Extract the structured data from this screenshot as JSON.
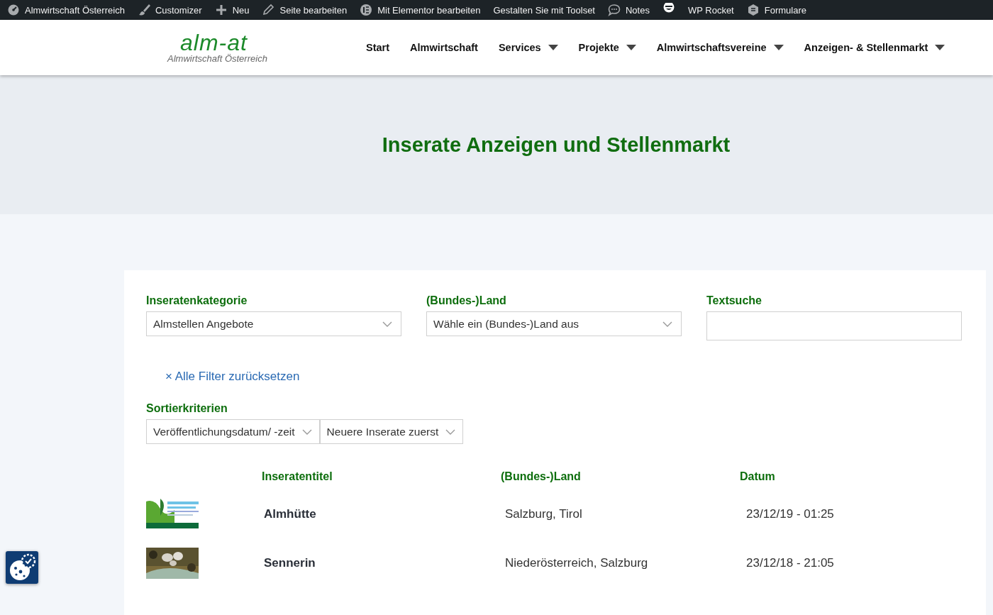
{
  "admin_bar": [
    {
      "kind": "dashboard",
      "label": "Almwirtschaft Österreich"
    },
    {
      "kind": "brush",
      "label": "Customizer"
    },
    {
      "kind": "plus",
      "label": "Neu"
    },
    {
      "kind": "pencil",
      "label": "Seite bearbeiten"
    },
    {
      "kind": "elementor",
      "label": "Mit Elementor bearbeiten"
    },
    {
      "kind": "none",
      "label": "Gestalten Sie mit Toolset"
    },
    {
      "kind": "comment",
      "label": "Notes"
    },
    {
      "kind": "face"
    },
    {
      "kind": "none",
      "label": "WP Rocket"
    },
    {
      "kind": "form",
      "label": "Formulare"
    }
  ],
  "logo": {
    "title": "alm-at",
    "subtitle": "Almwirtschaft Österreich"
  },
  "nav": [
    {
      "label": "Start",
      "dropdown": false
    },
    {
      "label": "Almwirtschaft",
      "dropdown": false
    },
    {
      "label": "Services",
      "dropdown": true
    },
    {
      "label": "Projekte",
      "dropdown": true
    },
    {
      "label": "Almwirtschaftsvereine",
      "dropdown": true
    },
    {
      "label": "Anzeigen- & Stellenmarkt",
      "dropdown": true
    }
  ],
  "hero": {
    "title": "Inserate Anzeigen und Stellenmarkt"
  },
  "filters": [
    {
      "label": "Inseratenkategorie",
      "kind": "select",
      "value": "Almstellen Angebote"
    },
    {
      "label": "(Bundes-)Land",
      "kind": "select",
      "value": "Wähle ein (Bundes-)Land aus"
    },
    {
      "label": "Textsuche",
      "kind": "text"
    }
  ],
  "reset_link": "× Alle Filter zurücksetzen",
  "sort": {
    "label": "Sortierkriterien",
    "selects": [
      "Veröffentlichungsdatum/ -zeit",
      "Neuere Inserate zuerst"
    ]
  },
  "table": {
    "columns": [
      "Inseratentitel",
      "(Bundes-)Land",
      "Datum"
    ],
    "rows": [
      {
        "title": "Almhütte",
        "land": "Salzburg, Tirol",
        "date": "23/12/19 - 01:25"
      },
      {
        "title": "Sennerin",
        "land": "Niederösterreich, Salzburg",
        "date": "23/12/18 - 21:05"
      }
    ]
  }
}
